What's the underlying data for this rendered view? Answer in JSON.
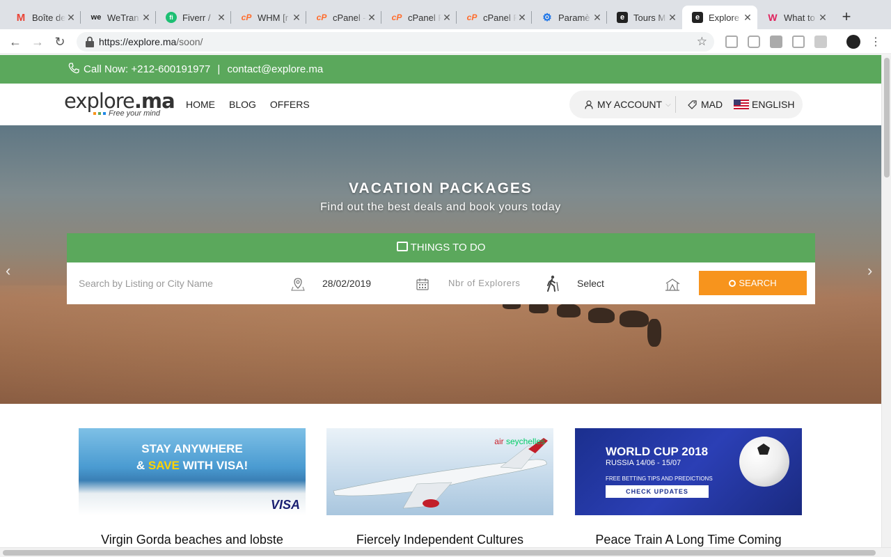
{
  "browser": {
    "tabs": [
      {
        "title": "Boîte de",
        "icon": "gmail-icon",
        "color": "#ea4335",
        "glyph": "M"
      },
      {
        "title": "WeTran",
        "icon": "wetransfer-icon",
        "color": "#222222",
        "glyph": "we"
      },
      {
        "title": "Fiverr /",
        "icon": "fiverr-icon",
        "color": "#1dbf73",
        "glyph": "fi"
      },
      {
        "title": "WHM [r",
        "icon": "cpanel-icon",
        "color": "#ff6c2c",
        "glyph": "cP"
      },
      {
        "title": "cPanel -",
        "icon": "cpanel-icon",
        "color": "#ff6c2c",
        "glyph": "cP"
      },
      {
        "title": "cPanel F",
        "icon": "cpanel-icon",
        "color": "#ff6c2c",
        "glyph": "cP"
      },
      {
        "title": "cPanel F",
        "icon": "cpanel-icon",
        "color": "#ff6c2c",
        "glyph": "cP"
      },
      {
        "title": "Paramè",
        "icon": "gear-icon",
        "color": "#1a73e8",
        "glyph": "⚙"
      },
      {
        "title": "Tours M",
        "icon": "explore-icon",
        "color": "#222222",
        "glyph": "e"
      },
      {
        "title": "Explore",
        "icon": "explore-icon",
        "color": "#222222",
        "glyph": "e"
      },
      {
        "title": "What to",
        "icon": "wix-icon",
        "color": "#e0245e",
        "glyph": "W"
      }
    ],
    "url_host": "https://explore.ma",
    "url_path": "/soon/"
  },
  "topbar": {
    "call_label": "Call Now: +212-600191977",
    "separator": "|",
    "email": "contact@explore.ma"
  },
  "header": {
    "logo_word": "explore",
    "logo_tld": ".ma",
    "logo_tagline": "Free your mind",
    "nav": [
      "HOME",
      "BLOG",
      "OFFERS"
    ],
    "account_label": "MY ACCOUNT",
    "currency": "MAD",
    "language": "ENGLISH"
  },
  "hero": {
    "title": "VACATION PACKAGES",
    "subtitle": "Find out the best deals and book yours today"
  },
  "search": {
    "tab_label": "THINGS TO DO",
    "location_placeholder": "Search by Listing or City Name",
    "date_value": "28/02/2019",
    "explorers_placeholder": "Nbr of Explorers",
    "category_value": "Select",
    "button_label": "SEARCH"
  },
  "cards": [
    {
      "title": "Virgin Gorda beaches and lobste",
      "banner_line1": "STAY ANYWHERE",
      "banner_amp": "& ",
      "banner_save": "SAVE",
      "banner_line2_rest": " WITH VISA!",
      "banner_brand": "VISA"
    },
    {
      "title": "Fiercely Independent Cultures",
      "banner_brand_small": "air",
      "banner_brand": "seychelles"
    },
    {
      "title": "Peace Train A Long Time Coming",
      "banner_title": "WORLD CUP 2018",
      "banner_dates": "RUSSIA 14/06 - 15/07",
      "banner_tips": "FREE BETTING TIPS AND PREDICTIONS",
      "banner_button": "CHECK UPDATES"
    }
  ],
  "colors": {
    "green": "#5ba85c",
    "orange": "#f7941d"
  }
}
